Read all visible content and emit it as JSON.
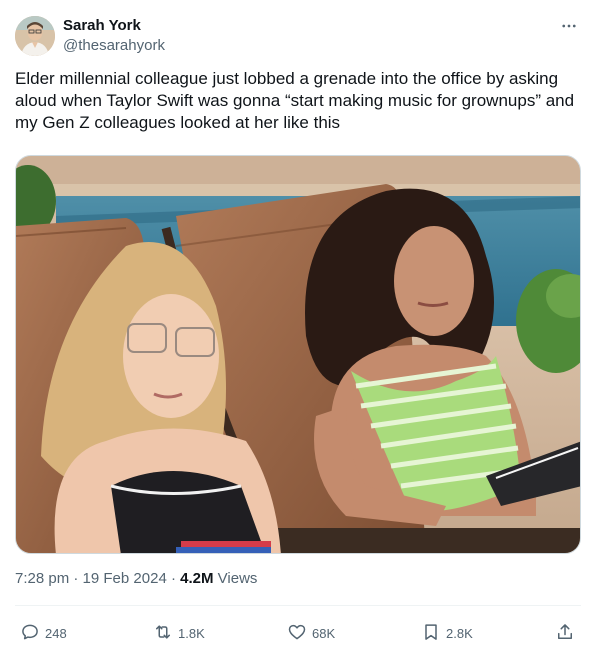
{
  "user": {
    "display_name": "Sarah York",
    "handle": "@thesarahyork",
    "avatar_icon": "user-avatar"
  },
  "tweet": {
    "text": "Elder millennial colleague just lobbed a grenade into the office by asking aloud when Taylor Swift was gonna “start making music for grownups” and my Gen Z colleagues looked at her like this"
  },
  "meta": {
    "time": "7:28 pm",
    "separator1": " · ",
    "date": "19 Feb 2024",
    "separator2": " · ",
    "views_count": "4.2M",
    "views_label": " Views"
  },
  "actions": {
    "replies": "248",
    "reposts": "1.8K",
    "likes": "68K",
    "bookmarks": "2.8K"
  },
  "icons": {
    "more": "more-horizontal-icon",
    "reply": "reply-icon",
    "repost": "repost-icon",
    "like": "heart-icon",
    "bookmark": "bookmark-icon",
    "share": "share-icon"
  },
  "colors": {
    "text_primary": "#0f1419",
    "text_secondary": "#536471",
    "border": "#cfd9de"
  }
}
